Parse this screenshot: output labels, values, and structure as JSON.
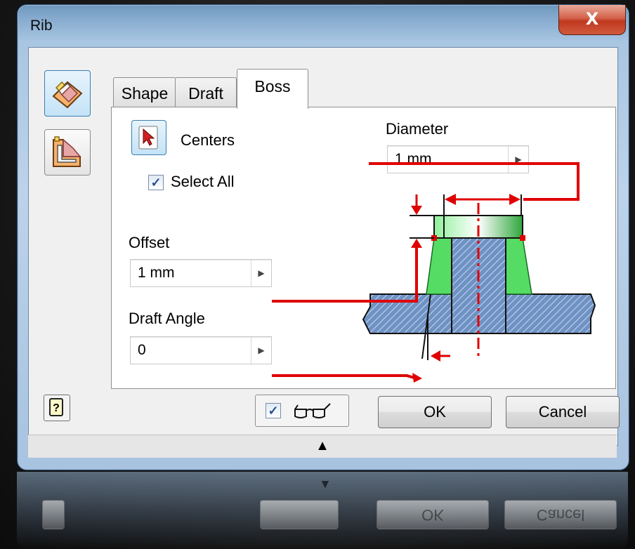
{
  "window": {
    "title": "Rib",
    "close_glyph": "X"
  },
  "tabs": [
    {
      "label": "Shape",
      "active": false
    },
    {
      "label": "Draft",
      "active": false
    },
    {
      "label": "Boss",
      "active": true
    }
  ],
  "boss": {
    "centers_label": "Centers",
    "select_all_label": "Select All",
    "select_all_checked": true,
    "diameter_label": "Diameter",
    "diameter_value": "1 mm",
    "offset_label": "Offset",
    "offset_value": "1 mm",
    "draft_angle_label": "Draft Angle",
    "draft_angle_value": "0"
  },
  "sidebar": {
    "icons": [
      "rib-normal-icon",
      "rib-plane-icon"
    ]
  },
  "footer": {
    "preview_checked": true,
    "preview_icon": "glasses-icon",
    "ok_label": "OK",
    "cancel_label": "Cancel",
    "help_icon": "help-icon",
    "expand_glyph": "▲"
  },
  "colors": {
    "accent_red": "#e00000",
    "boss_fill": "#6f92c4",
    "draft_green": "#4cdc5a",
    "title_bar": "#a9c6e2"
  }
}
